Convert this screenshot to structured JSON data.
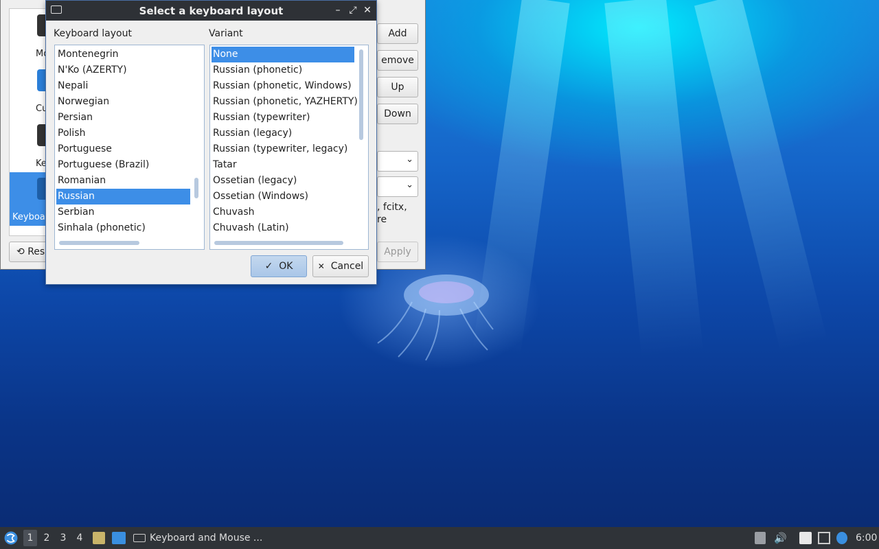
{
  "background_window": {
    "sidebar_items": [
      {
        "label": "Mo"
      },
      {
        "label": "Cu"
      },
      {
        "label": "Key"
      },
      {
        "label": "Keyboa"
      }
    ],
    "buttons": {
      "add": "Add",
      "remove": "emove",
      "up": "Up",
      "down": "Down"
    },
    "combo_arrow": "⌄",
    "info_text_line1": ", fcitx,",
    "info_text_line2": "re",
    "reset_label": "Res",
    "reset_icon": "undo-icon",
    "apply_label": "Apply"
  },
  "dialog": {
    "title": "Select a keyboard layout",
    "title_icon": "keyboard-icon",
    "controls": {
      "minimize": "–",
      "maximize": "⤢",
      "close": "✕"
    },
    "layout_header": "Keyboard layout",
    "variant_header": "Variant",
    "layouts": [
      {
        "label": "Montenegrin"
      },
      {
        "label": "N'Ko (AZERTY)"
      },
      {
        "label": "Nepali"
      },
      {
        "label": "Norwegian"
      },
      {
        "label": "Persian"
      },
      {
        "label": "Polish"
      },
      {
        "label": "Portuguese"
      },
      {
        "label": "Portuguese (Brazil)"
      },
      {
        "label": "Romanian"
      },
      {
        "label": "Russian",
        "selected": true
      },
      {
        "label": "Serbian"
      },
      {
        "label": "Sinhala (phonetic)"
      }
    ],
    "variants": [
      {
        "label": "None",
        "selected": true
      },
      {
        "label": "Russian (phonetic)"
      },
      {
        "label": "Russian (phonetic, Windows)"
      },
      {
        "label": "Russian (phonetic, YAZHERTY)"
      },
      {
        "label": "Russian (typewriter)"
      },
      {
        "label": "Russian (legacy)"
      },
      {
        "label": "Russian (typewriter, legacy)"
      },
      {
        "label": "Tatar"
      },
      {
        "label": "Ossetian (legacy)"
      },
      {
        "label": "Ossetian (Windows)"
      },
      {
        "label": "Chuvash"
      },
      {
        "label": "Chuvash (Latin)"
      }
    ],
    "ok_label": "OK",
    "ok_icon": "✓",
    "cancel_label": "Cancel",
    "cancel_icon": "✕"
  },
  "taskbar": {
    "workspaces": [
      "1",
      "2",
      "3",
      "4"
    ],
    "active_workspace": "1",
    "task_label": "Keyboard and Mouse ...",
    "clock": "6:00",
    "icons": [
      "start-menu-icon",
      "file-manager-icon",
      "desktop-icon",
      "keyboard-icon",
      "eject-icon",
      "volume-icon",
      "clipboard-icon",
      "network-icon",
      "notification-icon"
    ]
  },
  "colors": {
    "selection": "#3d8ee7",
    "titlebar": "#2e3136",
    "taskbar": "#2f3338"
  }
}
